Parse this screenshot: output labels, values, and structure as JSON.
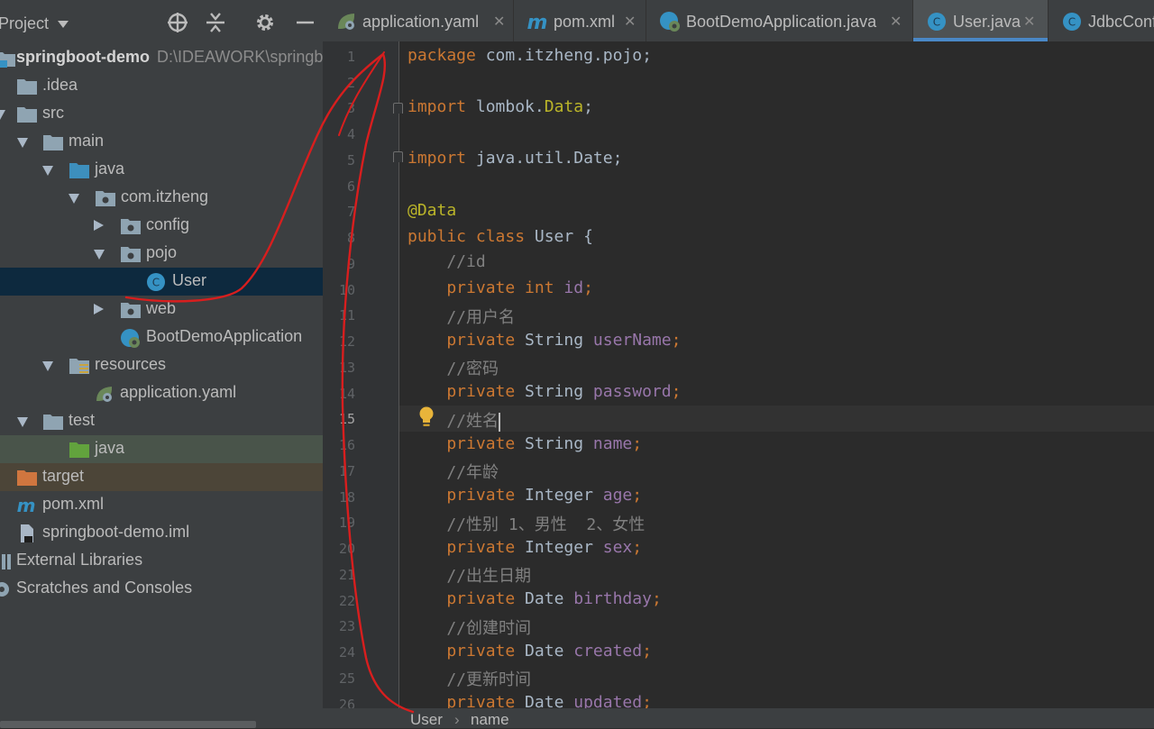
{
  "project_panel": {
    "title": "Project",
    "tree": [
      {
        "label": "springboot-demo",
        "hint": "D:\\IDEAWORK\\springb"
      },
      {
        "label": ".idea"
      },
      {
        "label": "src"
      },
      {
        "label": "main"
      },
      {
        "label": "java"
      },
      {
        "label": "com.itzheng"
      },
      {
        "label": "config"
      },
      {
        "label": "pojo"
      },
      {
        "label": "User"
      },
      {
        "label": "web"
      },
      {
        "label": "BootDemoApplication"
      },
      {
        "label": "resources"
      },
      {
        "label": "application.yaml"
      },
      {
        "label": "test"
      },
      {
        "label": "java"
      },
      {
        "label": "target"
      },
      {
        "label": "pom.xml"
      },
      {
        "label": "springboot-demo.iml"
      },
      {
        "label": "External Libraries"
      },
      {
        "label": "Scratches and Consoles"
      }
    ]
  },
  "tabs": [
    {
      "label": "application.yaml"
    },
    {
      "label": "pom.xml"
    },
    {
      "label": "BootDemoApplication.java"
    },
    {
      "label": "User.java"
    },
    {
      "label": "JdbcConf"
    }
  ],
  "editor": {
    "line_numbers": [
      "1",
      "2",
      "3",
      "4",
      "5",
      "6",
      "7",
      "8",
      "9",
      "10",
      "11",
      "12",
      "13",
      "14",
      "15",
      "16",
      "17",
      "18",
      "19",
      "20",
      "21",
      "22",
      "23",
      "24",
      "25",
      "26"
    ],
    "current_line": "15",
    "code": {
      "l1_kw": "package",
      "l1_rest": " com.itzheng.pojo;",
      "l3_kw": "import",
      "l3_a": " lombok.",
      "l3_b": "Data",
      "l3_c": ";",
      "l5_kw": "import",
      "l5_rest": " java.util.Date;",
      "l7_ann": "@Data",
      "l8_kw": "public class",
      "l8_rest": " User {",
      "l9_cmt": "    //id",
      "l10_kw": "    private int",
      "l10_fld": " id",
      "l10_end": ";",
      "l11_cmt": "    //用户名",
      "l12_kw": "    private",
      "l12_typ": " String",
      "l12_fld": " userName",
      "l12_end": ";",
      "l13_cmt": "    //密码",
      "l14_kw": "    private",
      "l14_typ": " String",
      "l14_fld": " password",
      "l14_end": ";",
      "l15_cmt": "    //姓名",
      "l16_kw": "    private",
      "l16_typ": " String",
      "l16_fld": " name",
      "l16_end": ";",
      "l17_cmt": "    //年龄",
      "l18_kw": "    private",
      "l18_typ": " Integer",
      "l18_fld": " age",
      "l18_end": ";",
      "l19_cmt": "    //性别 1、男性  2、女性",
      "l20_kw": "    private",
      "l20_typ": " Integer",
      "l20_fld": " sex",
      "l20_end": ";",
      "l21_cmt": "    //出生日期",
      "l22_kw": "    private",
      "l22_typ": " Date",
      "l22_fld": " birthday",
      "l22_end": ";",
      "l23_cmt": "    //创建时间",
      "l24_kw": "    private",
      "l24_typ": " Date",
      "l24_fld": " created",
      "l24_end": ";",
      "l25_cmt": "    //更新时间",
      "l26_kw": "    private",
      "l26_typ": " Date",
      "l26_fld": " updated",
      "l26_end": ";"
    }
  },
  "breadcrumb": {
    "class": "User",
    "field": "name",
    "separator": "›"
  },
  "colors": {
    "accent": "#4a88c7",
    "annotation_stroke": "#d81e1e"
  }
}
